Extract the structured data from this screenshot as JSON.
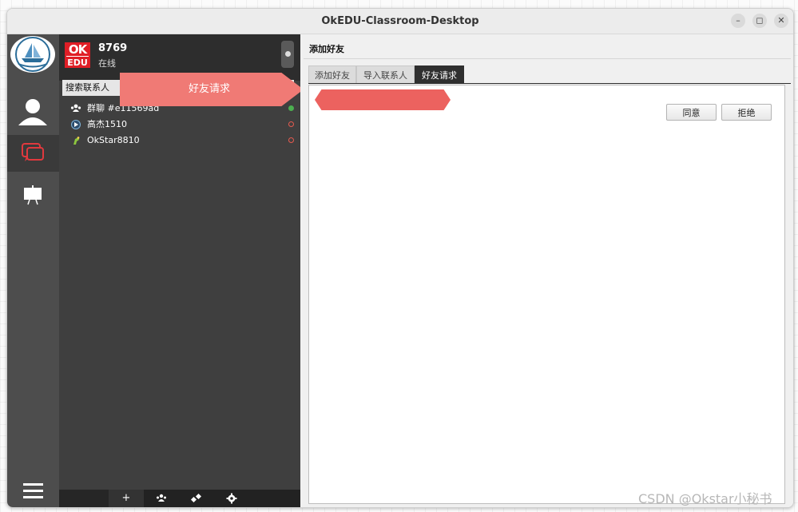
{
  "window": {
    "title": "OkEDU-Classroom-Desktop",
    "controls": [
      "–",
      "◻",
      "✕"
    ]
  },
  "user": {
    "logo_line1": "OK",
    "logo_line2": "EDU",
    "name": "8769",
    "status": "在线"
  },
  "search": {
    "placeholder": "搜索联系人"
  },
  "annotation": {
    "label": "好友请求"
  },
  "contacts": [
    {
      "icon": "group-icon",
      "name": "群聊 #e11569ad",
      "status": "online",
      "color": "#4caf50"
    },
    {
      "icon": "avatar-icon",
      "name": "高杰1510",
      "status": "offline",
      "color": "#e65a4f"
    },
    {
      "icon": "avatar-icon",
      "name": "OkStar8810",
      "status": "offline",
      "color": "#e65a4f"
    }
  ],
  "bottom_bar": {
    "add": "+"
  },
  "right_panel": {
    "title": "添加好友",
    "tabs": [
      {
        "label": "添加好友",
        "active": false
      },
      {
        "label": "导入联系人",
        "active": false
      },
      {
        "label": "好友请求",
        "active": true
      }
    ],
    "accept_label": "同意",
    "reject_label": "拒绝"
  },
  "watermark": "CSDN @Okstar小秘书",
  "colors": {
    "annotation": "#f07a75",
    "redaction": "#ec625f",
    "accent_red": "#e01e26"
  }
}
